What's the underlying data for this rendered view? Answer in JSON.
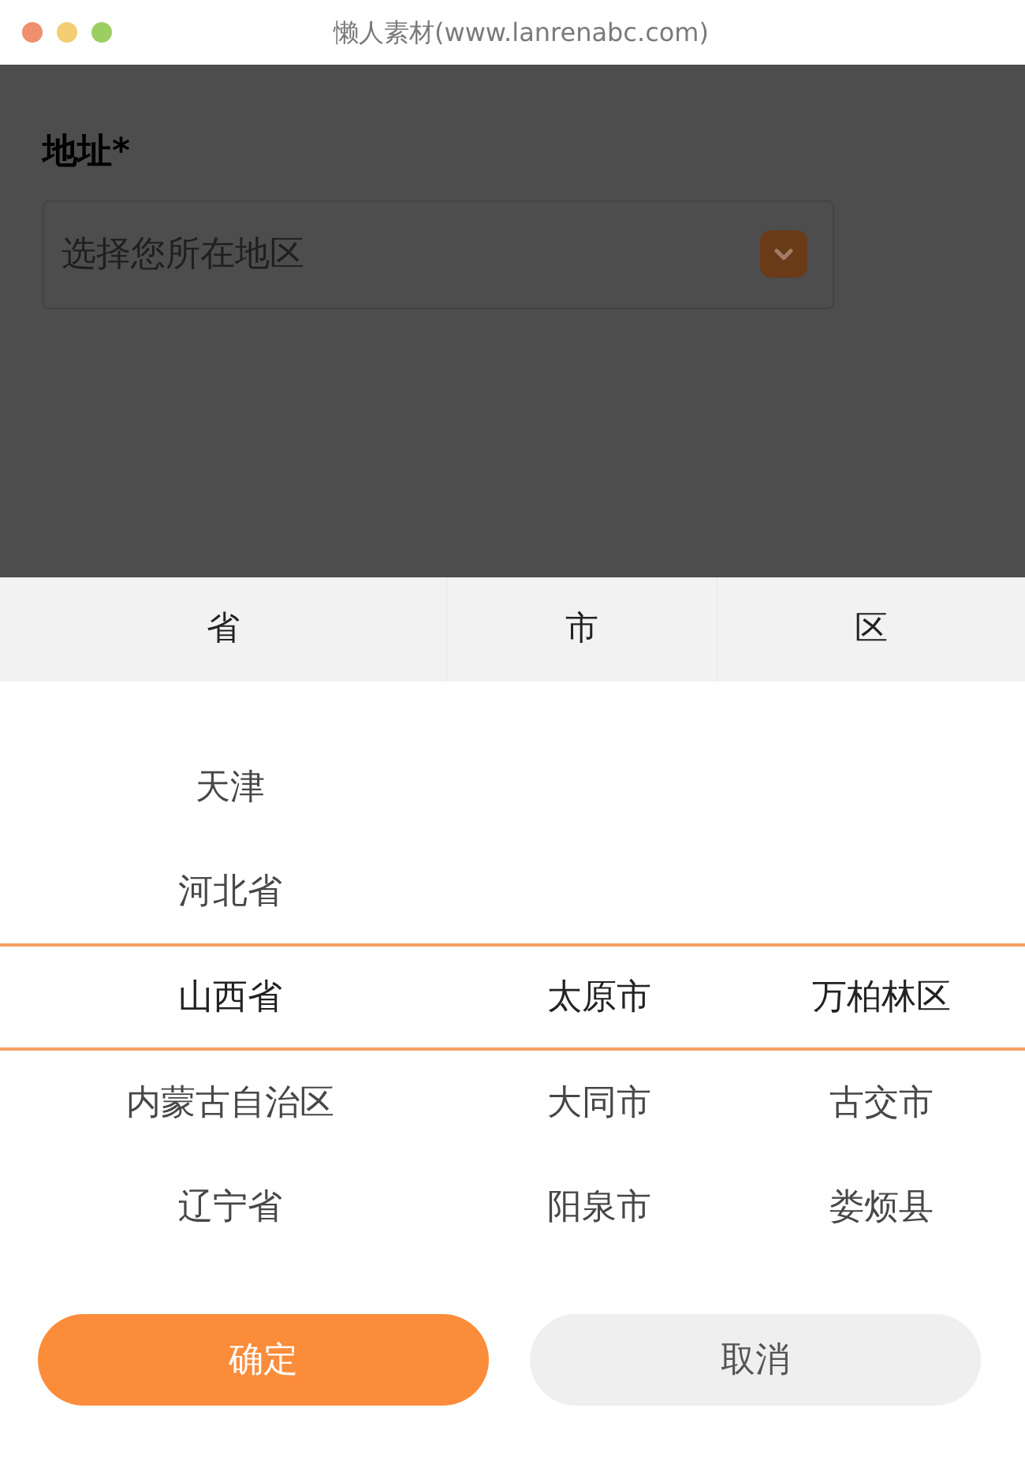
{
  "window": {
    "title": "懒人素材(www.lanrenabc.com)"
  },
  "form": {
    "label": "地址*",
    "placeholder": "选择您所在地区"
  },
  "picker": {
    "headers": [
      {
        "label": "省"
      },
      {
        "label": "市"
      },
      {
        "label": "区"
      }
    ],
    "columns": [
      {
        "options": [
          {
            "label": "天津",
            "selected": false
          },
          {
            "label": "河北省",
            "selected": false
          },
          {
            "label": "山西省",
            "selected": true
          },
          {
            "label": "内蒙古自治区",
            "selected": false
          },
          {
            "label": "辽宁省",
            "selected": false
          }
        ]
      },
      {
        "options": [
          {
            "label": "太原市",
            "selected": true
          },
          {
            "label": "大同市",
            "selected": false
          },
          {
            "label": "阳泉市",
            "selected": false
          }
        ]
      },
      {
        "options": [
          {
            "label": "万柏林区",
            "selected": true
          },
          {
            "label": "古交市",
            "selected": false
          },
          {
            "label": "娄烦县",
            "selected": false
          }
        ]
      }
    ]
  },
  "buttons": [
    {
      "label": "确定",
      "kind": "primary"
    },
    {
      "label": "取消",
      "kind": "secondary"
    }
  ]
}
